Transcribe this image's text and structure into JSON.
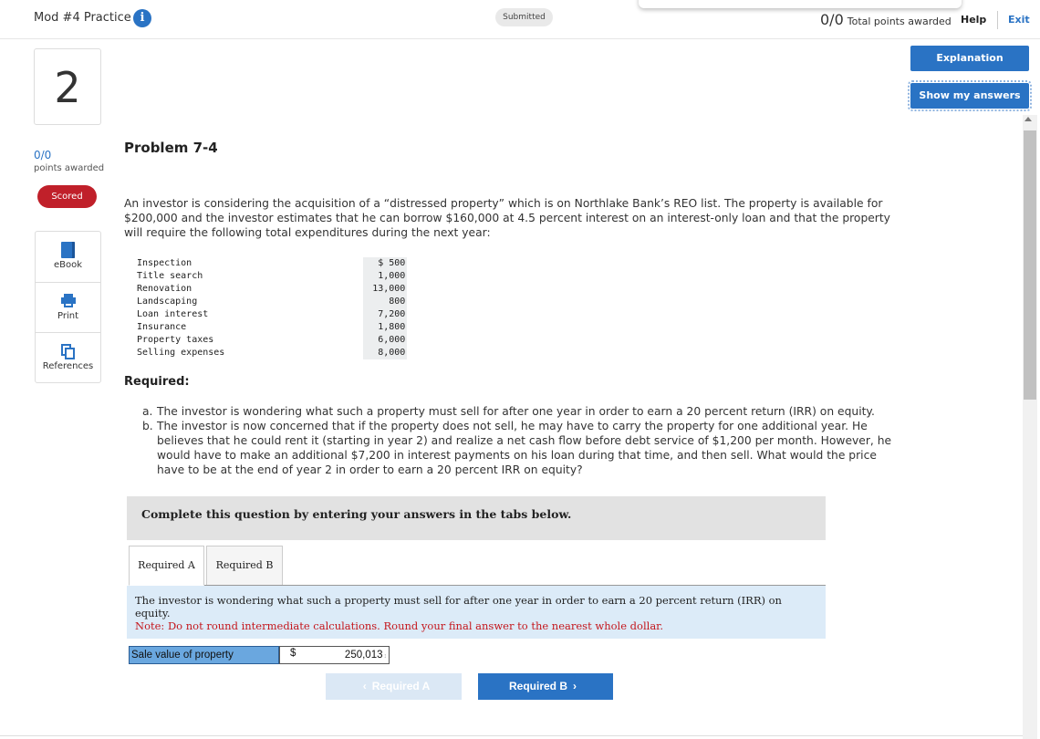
{
  "header": {
    "title": "Mod #4 Practice",
    "status_badge": "Submitted",
    "total_points_value": "0/0",
    "total_points_label": "Total points awarded",
    "help": "Help",
    "exit": "Exit"
  },
  "side_actions": {
    "explanation": "Explanation",
    "show_answers": "Show my answers"
  },
  "question": {
    "number": "2",
    "points": "0/0",
    "points_label": "points awarded",
    "status": "Scored"
  },
  "resources": [
    {
      "label": "eBook",
      "icon": "book-icon"
    },
    {
      "label": "Print",
      "icon": "printer-icon"
    },
    {
      "label": "References",
      "icon": "references-icon"
    }
  ],
  "problem": {
    "title": "Problem 7-4",
    "intro": "An investor is considering the acquisition of a “distressed property” which is on Northlake Bank’s REO list. The property is available for $200,000 and the investor estimates that he can borrow $160,000 at 4.5 percent interest on an interest-only loan and that the property will require the following total expenditures during the next year:",
    "expenditures": [
      {
        "item": "Inspection",
        "amount": "$ 500"
      },
      {
        "item": "Title search",
        "amount": "1,000"
      },
      {
        "item": "Renovation",
        "amount": "13,000"
      },
      {
        "item": "Landscaping",
        "amount": "800"
      },
      {
        "item": "Loan interest",
        "amount": "7,200"
      },
      {
        "item": "Insurance",
        "amount": "1,800"
      },
      {
        "item": "Property taxes",
        "amount": "6,000"
      },
      {
        "item": "Selling expenses",
        "amount": "8,000"
      }
    ],
    "required_heading": "Required:",
    "req_a_letter": "a.",
    "req_a_text": "The investor is wondering what such a property must sell for after one year in order to earn a 20 percent return (IRR) on equity.",
    "req_b_letter": "b.",
    "req_b_text": "The investor is now concerned that if the property does not sell, he may have to carry the property for one additional year. He believes that he could rent it (starting in year 2) and realize a net cash flow before debt service of $1,200 per month. However, he would have to make an additional $7,200 in interest payments on his loan during that time, and then sell. What would the price have to be at the end of year 2 in order to earn a 20 percent IRR on equity?"
  },
  "answer_section": {
    "banner": "Complete this question by entering your answers in the tabs below.",
    "tabs": [
      "Required A",
      "Required B"
    ],
    "panel_text": "The investor is wondering what such a property must sell for after one year in order to earn a 20 percent return (IRR) on equity.",
    "panel_note": "Note: Do not round intermediate calculations. Round your final answer to the nearest whole dollar.",
    "field_label": "Sale value of property",
    "currency": "$",
    "field_value": "250,013",
    "prev_button": "Required A",
    "next_button": "Required B"
  },
  "colors": {
    "brand_blue": "#2a73c4",
    "scored_red": "#c0202a",
    "note_red": "#c4161c",
    "panel_blue": "#dcebf8"
  }
}
